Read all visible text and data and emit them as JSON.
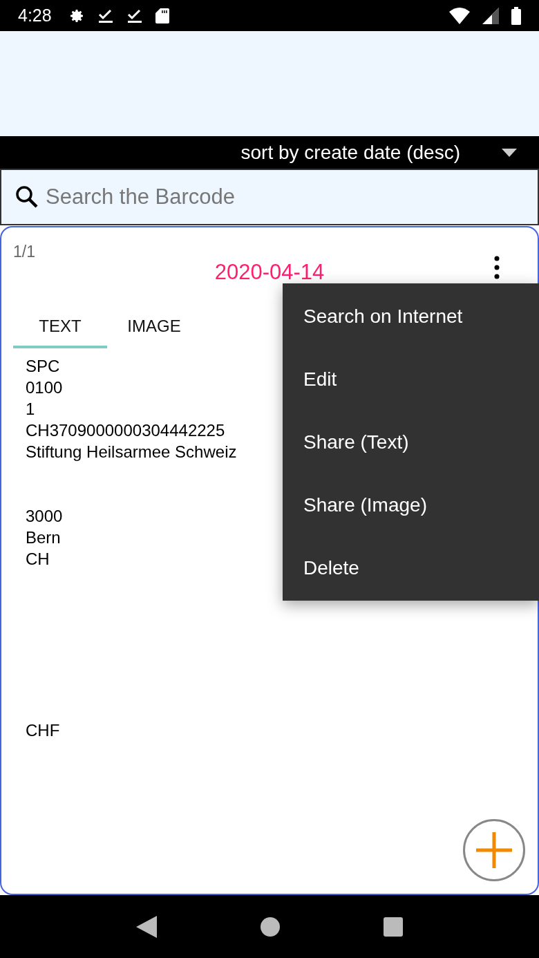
{
  "status_bar": {
    "time": "4:28"
  },
  "sort": {
    "label": "sort by create date (desc)"
  },
  "search": {
    "placeholder": "Search the Barcode"
  },
  "card": {
    "counter": "1/1",
    "date": "2020-04-14",
    "tabs": [
      {
        "label": "TEXT",
        "selected": true
      },
      {
        "label": "IMAGE",
        "selected": false
      }
    ],
    "text": "SPC\n0100\n1\nCH3709000000304442225\nStiftung Heilsarmee Schweiz\n\n\n3000\nBern\nCH\n\n\n\n\n\n\n\nCHF"
  },
  "menu": [
    {
      "label": "Search on Internet"
    },
    {
      "label": "Edit"
    },
    {
      "label": "Share (Text)"
    },
    {
      "label": "Share (Image)"
    },
    {
      "label": "Delete"
    }
  ]
}
